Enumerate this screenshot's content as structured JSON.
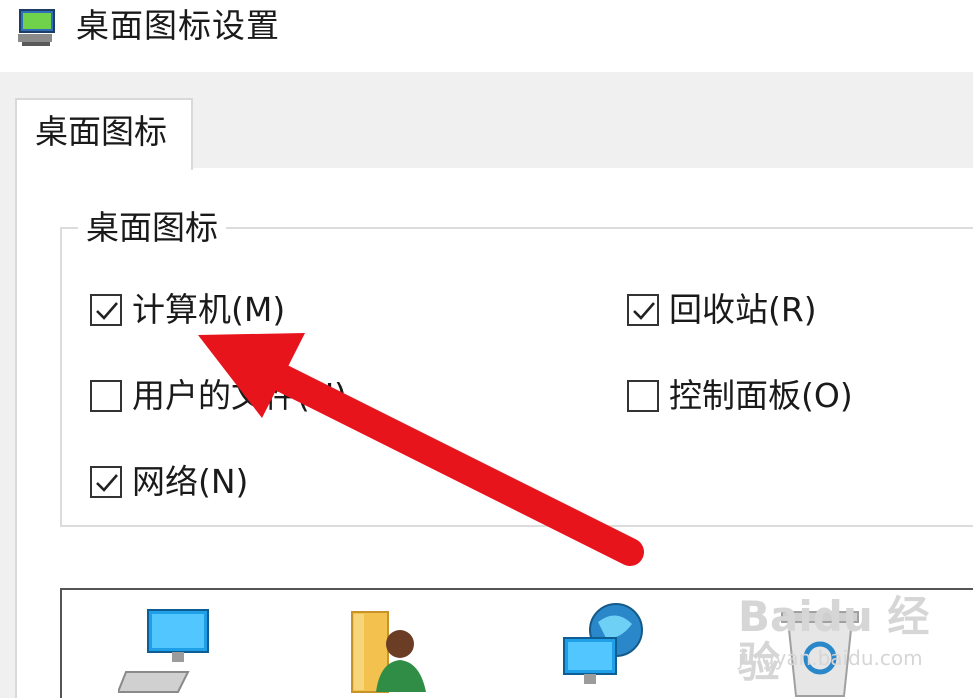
{
  "window": {
    "title": "桌面图标设置",
    "icon": "display-settings-icon"
  },
  "tabs": [
    {
      "label": "桌面图标",
      "selected": true
    }
  ],
  "group": {
    "legend": "桌面图标",
    "checkboxes": [
      {
        "label": "计算机(M)",
        "checked": true
      },
      {
        "label": "回收站(R)",
        "checked": true
      },
      {
        "label": "用户的文件(U)",
        "checked": false
      },
      {
        "label": "控制面板(O)",
        "checked": false
      },
      {
        "label": "网络(N)",
        "checked": true
      }
    ]
  },
  "icon_list": [
    {
      "name": "computer-icon"
    },
    {
      "name": "user-files-icon"
    },
    {
      "name": "network-icon"
    },
    {
      "name": "recycle-bin-icon"
    }
  ],
  "annotation": {
    "type": "red-arrow",
    "target": "计算机(M)",
    "color": "#e8141b"
  },
  "watermark": {
    "main": "Baidu 经验",
    "sub": "jingyan.baidu.com"
  }
}
